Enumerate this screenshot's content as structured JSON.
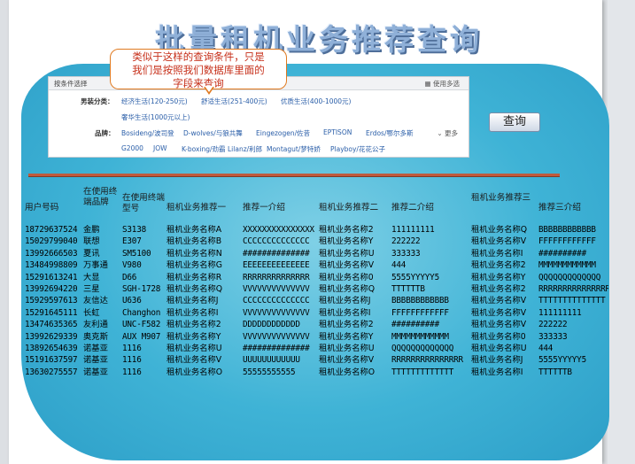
{
  "title": "批量租机业务推荐查询",
  "callout": {
    "line1": "类似于这样的查询条件，只是",
    "line2": "我们是按照我们数据库里面的",
    "line3": "字段来查询"
  },
  "filter": {
    "header_label": "按条件选择",
    "multi_label": "使用多选",
    "rows": [
      {
        "key": "男装分类：",
        "options": [
          "经济生活(120-250元)",
          "舒适生活(251-400元)",
          "优质生活(400-1000元)"
        ]
      },
      {
        "key": "",
        "options": [
          "奢华生活(1000元以上)"
        ]
      },
      {
        "key": "品牌：",
        "options": [
          "Bosideng/波司登",
          "D-wolves/与狼共舞",
          "Eingezogen/佐昔",
          "EPTISON",
          "Erdos/鄂尔多斯"
        ],
        "more": "更多"
      },
      {
        "key": "",
        "options": [
          "G2000",
          "JOW",
          "K-boxing/劲霸",
          "Lilanz/利郎",
          "Montagut/梦特娇",
          "Playboy/花花公子"
        ]
      }
    ]
  },
  "query_button": "查询",
  "table": {
    "headers": [
      "用户号码",
      "在使用终端品牌",
      "在使用终端型号",
      "租机业务推荐一",
      "推荐一介绍",
      "租机业务推荐二",
      "推荐二介绍",
      "租机业务推荐三",
      "推荐三介绍"
    ],
    "rows": [
      [
        "18729637524",
        "金鹏",
        "S3138",
        "租机业务名称A",
        "XXXXXXXXXXXXXXX",
        "租机业务名称2",
        "111111111",
        "租机业务名称Q",
        "BBBBBBBBBBBB"
      ],
      [
        "15029799040",
        "联想",
        "E307",
        "租机业务名称B",
        "CCCCCCCCCCCCCC",
        "租机业务名称Y",
        "222222",
        "租机业务名称V",
        "FFFFFFFFFFFF"
      ],
      [
        "13992666503",
        "夏讯",
        "SM5100",
        "租机业务名称N",
        "##############",
        "租机业务名称U",
        "333333",
        "租机业务名称I",
        "##########"
      ],
      [
        "13484998809",
        "万事通",
        "V980",
        "租机业务名称G",
        "EEEEEEEEEEEEEE",
        "租机业务名称V",
        "444",
        "租机业务名称2",
        "MMMMMMMMMMMM"
      ],
      [
        "15291613241",
        "大显",
        "D66",
        "租机业务名称R",
        "RRRRRRRRRRRRRR",
        "租机业务名称0",
        "5555YYYYY5",
        "租机业务名称Y",
        "QQQQQQQQQQQQQ"
      ],
      [
        "13992694220",
        "三星",
        "SGH-1728",
        "租机业务名称Q",
        "VVVVVVVVVVVVVV",
        "租机业务名称Q",
        "TTTTTTB",
        "租机业务名称2",
        "RRRRRRRRRRRRRRR"
      ],
      [
        "15929597613",
        "友信达",
        "U636",
        "租机业务名称J",
        "CCCCCCCCCCCCCC",
        "租机业务名称J",
        "BBBBBBBBBBBB",
        "租机业务名称V",
        "TTTTTTTTTTTTTT"
      ],
      [
        "15291645111",
        "长虹",
        "Changhon",
        "租机业务名称I",
        "VVVVVVVVVVVVVV",
        "租机业务名称I",
        "FFFFFFFFFFFF",
        "租机业务名称V",
        "111111111"
      ],
      [
        "13474635365",
        "友利通",
        "UNC-F582",
        "租机业务名称2",
        "DDDDDDDDDDDD",
        "租机业务名称2",
        "##########",
        "租机业务名称V",
        "222222"
      ],
      [
        "13992629339",
        "奥克斯",
        "AUX M907",
        "租机业务名称Y",
        "VVVVVVVVVVVVVV",
        "租机业务名称Y",
        "MMMMMMMMMMMM",
        "租机业务名称0",
        "333333"
      ],
      [
        "13892654639",
        "诺基亚",
        "1116",
        "租机业务名称U",
        "##############",
        "租机业务名称U",
        "QQQQQQQQQQQQQ",
        "租机业务名称U",
        "444"
      ],
      [
        "15191637597",
        "诺基亚",
        "1116",
        "租机业务名称V",
        "UUUUUUUUUUUU",
        "租机业务名称V",
        "RRRRRRRRRRRRRRR",
        "租机业务名称J",
        "5555YYYYY5"
      ],
      [
        "13630275557",
        "诺基亚",
        "1116",
        "租机业务名称O",
        "55555555555",
        "租机业务名称O",
        "TTTTTTTTTTTTT",
        "租机业务名称I",
        "TTTTTTB"
      ]
    ]
  }
}
